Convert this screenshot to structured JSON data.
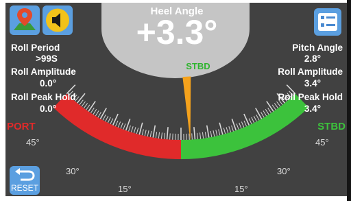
{
  "heel": {
    "title": "Heel Angle",
    "value": "+3.3°",
    "side": "STBD"
  },
  "left_readouts": [
    {
      "label": "Roll Period",
      "value": ">99S"
    },
    {
      "label": "Roll Amplitude",
      "value": "0.0°"
    },
    {
      "label": "Roll Peak Hold",
      "value": "0.0°"
    }
  ],
  "right_readouts": [
    {
      "label": "Pitch Angle",
      "value": "2.8°"
    },
    {
      "label": "Roll Amplitude",
      "value": "3.4°"
    },
    {
      "label": "Roll Peak Hold",
      "value": "3.4°"
    }
  ],
  "gauge": {
    "port_label": "PORT",
    "stbd_label": "STBD",
    "ticks": {
      "left_45": "45°",
      "left_30": "30°",
      "left_15": "15°",
      "right_45": "45°",
      "right_30": "30°",
      "right_15": "15°"
    },
    "needle_angle_deg": 3.3,
    "heel_shown_deg": 3.3,
    "max_deg": 45
  },
  "buttons": {
    "reset_label": "RESET",
    "map_icon": "map-pin-icon",
    "sound_icon": "speaker-icon",
    "menu_icon": "list-menu-icon"
  },
  "colors": {
    "port": "#e02a2a",
    "stbd": "#3cc23c",
    "needle": "#f5a21c",
    "background": "#414141",
    "dome": "#c5c5c5",
    "accent_blue": "#5b9fe0"
  }
}
